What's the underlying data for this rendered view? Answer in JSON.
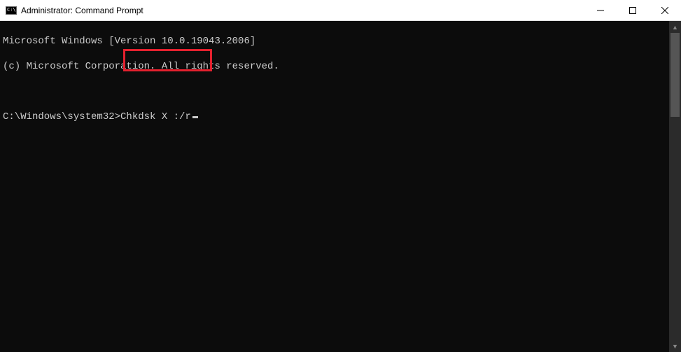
{
  "window": {
    "title": "Administrator: Command Prompt",
    "icon_label": "C:\\"
  },
  "terminal": {
    "line1": "Microsoft Windows [Version 10.0.19043.2006]",
    "line2": "(c) Microsoft Corporation. All rights reserved.",
    "prompt_path": "C:\\Windows\\system32>",
    "command": "Chkdsk X :/r"
  },
  "controls": {
    "minimize": "minimize",
    "maximize": "maximize",
    "close": "close"
  }
}
